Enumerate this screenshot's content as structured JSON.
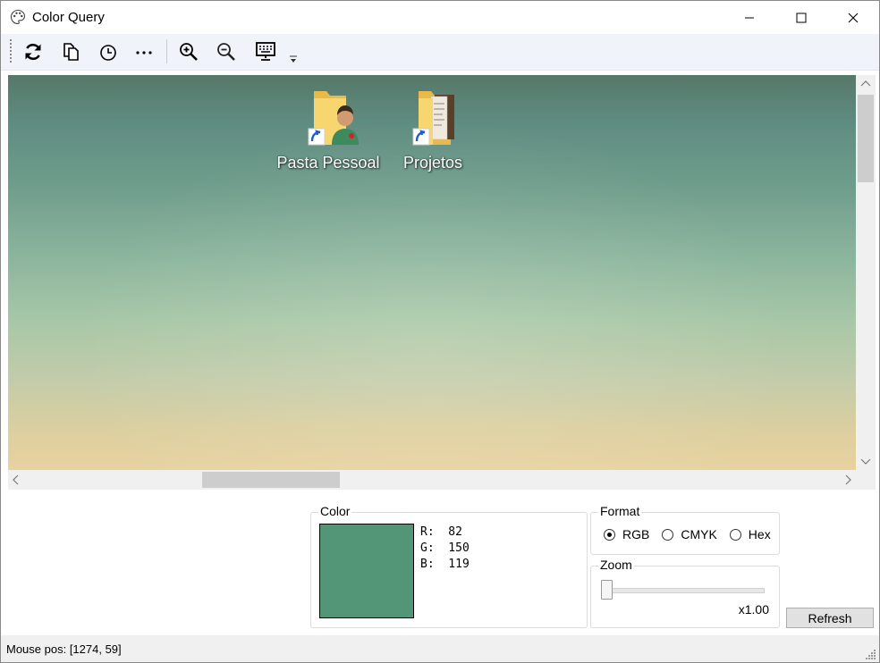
{
  "window": {
    "title": "Color Query"
  },
  "title_buttons": {
    "minimize": "minimize",
    "maximize": "maximize",
    "close": "close"
  },
  "toolbar": {
    "buttons": [
      {
        "name": "refresh",
        "icon": "refresh-icon"
      },
      {
        "name": "copy",
        "icon": "copy-icon"
      },
      {
        "name": "history",
        "icon": "clock-icon"
      },
      {
        "name": "more",
        "icon": "more-icon"
      },
      {
        "name": "zoom-in",
        "icon": "zoom-in-icon"
      },
      {
        "name": "zoom-out",
        "icon": "zoom-out-icon"
      },
      {
        "name": "screen",
        "icon": "monitor-keyboard-icon"
      }
    ]
  },
  "desktop": {
    "icons": [
      {
        "label": "Pasta Pessoal",
        "icon": "personal-folder-icon"
      },
      {
        "label": "Projetos",
        "icon": "projects-folder-icon"
      }
    ]
  },
  "color": {
    "title": "Color",
    "swatch_hex": "#529677",
    "r_line": "R:  82",
    "g_line": "G:  150",
    "b_line": "B:  119"
  },
  "format": {
    "title": "Format",
    "options": [
      {
        "label": "RGB",
        "checked": true
      },
      {
        "label": "CMYK",
        "checked": false
      },
      {
        "label": "Hex",
        "checked": false
      }
    ]
  },
  "zoom": {
    "title": "Zoom",
    "value_label": "x1.00",
    "slider_fraction": 0
  },
  "refresh_label": "Refresh",
  "status": {
    "mouse_pos": "Mouse pos: [1274, 59]"
  },
  "colors": {
    "accent_toolbar": "#f0f4fa",
    "status_bar": "#f0f0f0"
  }
}
